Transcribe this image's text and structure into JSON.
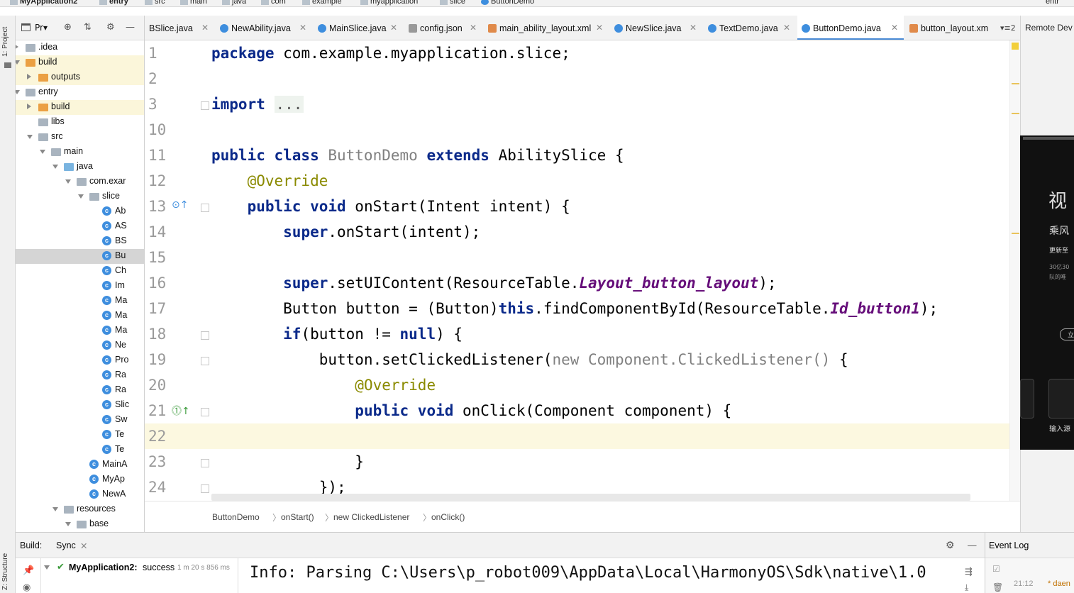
{
  "navbar": {
    "project": "MyApplication2",
    "crumbs": [
      "entry",
      "src",
      "main",
      "java",
      "com",
      "example",
      "myapplication",
      "slice",
      "ButtonDemo"
    ],
    "right_label": "entr"
  },
  "left_strip": {
    "project_tab": "1: Project",
    "structure_tab": "Z: Structure"
  },
  "project_panel": {
    "view_label": "Pr▾",
    "tree": [
      {
        "label": ".idea",
        "kind": "folder-gray",
        "arrow": "right"
      },
      {
        "label": "build",
        "kind": "folder-orange",
        "arrow": "down"
      },
      {
        "label": "outputs",
        "kind": "folder-orange",
        "arrow": "right"
      },
      {
        "label": "entry",
        "kind": "folder-gray",
        "arrow": "down"
      },
      {
        "label": "build",
        "kind": "folder-orange",
        "arrow": "right"
      },
      {
        "label": "libs",
        "kind": "folder-gray",
        "arrow": ""
      },
      {
        "label": "src",
        "kind": "folder-gray",
        "arrow": "down"
      },
      {
        "label": "main",
        "kind": "folder-gray",
        "arrow": "down"
      },
      {
        "label": "java",
        "kind": "folder-blue",
        "arrow": "down"
      },
      {
        "label": "com.exar",
        "kind": "folder-gray",
        "arrow": "down"
      },
      {
        "label": "slice",
        "kind": "folder-gray",
        "arrow": "down"
      },
      {
        "label": "Ab",
        "kind": "class",
        "arrow": ""
      },
      {
        "label": "AS",
        "kind": "class",
        "arrow": ""
      },
      {
        "label": "BS",
        "kind": "class",
        "arrow": ""
      },
      {
        "label": "Bu",
        "kind": "class",
        "arrow": ""
      },
      {
        "label": "Ch",
        "kind": "class",
        "arrow": ""
      },
      {
        "label": "Im",
        "kind": "class",
        "arrow": ""
      },
      {
        "label": "Ma",
        "kind": "class",
        "arrow": ""
      },
      {
        "label": "Ma",
        "kind": "class",
        "arrow": ""
      },
      {
        "label": "Ma",
        "kind": "class",
        "arrow": ""
      },
      {
        "label": "Ne",
        "kind": "class",
        "arrow": ""
      },
      {
        "label": "Pro",
        "kind": "class",
        "arrow": ""
      },
      {
        "label": "Ra",
        "kind": "class",
        "arrow": ""
      },
      {
        "label": "Ra",
        "kind": "class",
        "arrow": ""
      },
      {
        "label": "Slic",
        "kind": "class",
        "arrow": ""
      },
      {
        "label": "Sw",
        "kind": "class",
        "arrow": ""
      },
      {
        "label": "Te",
        "kind": "class",
        "arrow": ""
      },
      {
        "label": "Te",
        "kind": "class",
        "arrow": ""
      },
      {
        "label": "MainA",
        "kind": "class",
        "arrow": ""
      },
      {
        "label": "MyAp",
        "kind": "class",
        "arrow": ""
      },
      {
        "label": "NewA",
        "kind": "class",
        "arrow": ""
      },
      {
        "label": "resources",
        "kind": "folder-gray",
        "arrow": "down"
      },
      {
        "label": "base",
        "kind": "folder-gray",
        "arrow": "down"
      }
    ]
  },
  "tabs": [
    {
      "label": "BSlice.java",
      "icon": "none",
      "active": false
    },
    {
      "label": "NewAbility.java",
      "icon": "class",
      "active": false
    },
    {
      "label": "MainSlice.java",
      "icon": "class",
      "active": false
    },
    {
      "label": "config.json",
      "icon": "json",
      "active": false
    },
    {
      "label": "main_ability_layout.xml",
      "icon": "xml",
      "active": false
    },
    {
      "label": "NewSlice.java",
      "icon": "class",
      "active": false
    },
    {
      "label": "TextDemo.java",
      "icon": "class",
      "active": false
    },
    {
      "label": "ButtonDemo.java",
      "icon": "class",
      "active": true
    },
    {
      "label": "button_layout.xm",
      "icon": "xml",
      "active": false
    }
  ],
  "tab_overflow": "▾≡2",
  "editor": {
    "line_numbers": [
      "1",
      "2",
      "3",
      "10",
      "11",
      "12",
      "13",
      "14",
      "15",
      "16",
      "17",
      "18",
      "19",
      "20",
      "21",
      "22",
      "23",
      "24"
    ],
    "code": {
      "l1_kw": "package",
      "l1_rest": " com.example.myapplication.slice;",
      "l3_kw": "import",
      "l3_fold": "...",
      "l11_kw1": "public class",
      "l11_name": " ButtonDemo ",
      "l11_kw2": "extends",
      "l11_rest": " AbilitySlice {",
      "l12_ann": "@Override",
      "l13_kw": "public void",
      "l13_rest": " onStart(Intent intent) {",
      "l14_kw": "super",
      "l14_rest": ".onStart(intent);",
      "l16_kw": "super",
      "l16_a": ".setUIContent(ResourceTable.",
      "l16_fld": "Layout_button_layout",
      "l16_b": ");",
      "l17_a": "Button button = (Button)",
      "l17_kw": "this",
      "l17_b": ".findComponentById(ResourceTable.",
      "l17_fld": "Id_button1",
      "l17_c": ");",
      "l18_kw": "if",
      "l18_a": "(button != ",
      "l18_kw2": "null",
      "l18_b": ") {",
      "l19_a": "button.setClickedListener(",
      "l19_gr": "new Component.ClickedListener()",
      "l19_b": " {",
      "l20_ann": "@Override",
      "l21_kw": "public void",
      "l21_rest": " onClick(Component component) {",
      "l23": "}",
      "l24": "});"
    }
  },
  "breadcrumb": [
    "ButtonDemo",
    "onStart()",
    "new ClickedListener",
    "onClick()"
  ],
  "right_strip": {
    "remote_label": "Remote Dev",
    "preview_texts": [
      "视",
      "乘风",
      "更新至",
      "30亿30",
      "队的唯",
      "立",
      "输入源"
    ]
  },
  "build": {
    "title": "Build:",
    "sync_tab": "Sync",
    "tree_project": "MyApplication2:",
    "tree_status": "success",
    "tree_time": "1 m 20 s 856 ms",
    "output_line": "Info: Parsing C:\\Users\\p_robot009\\AppData\\Local\\HarmonyOS\\Sdk\\native\\1.0"
  },
  "event_log": {
    "title": "Event Log",
    "time": "21:12",
    "entry": "* daen"
  },
  "colors": {
    "keyword": "#0b2a8a",
    "annotation": "#8a8a00",
    "field": "#660e7a",
    "active_tab_underline": "#4a8bd6",
    "current_line": "#fcf8e0"
  }
}
